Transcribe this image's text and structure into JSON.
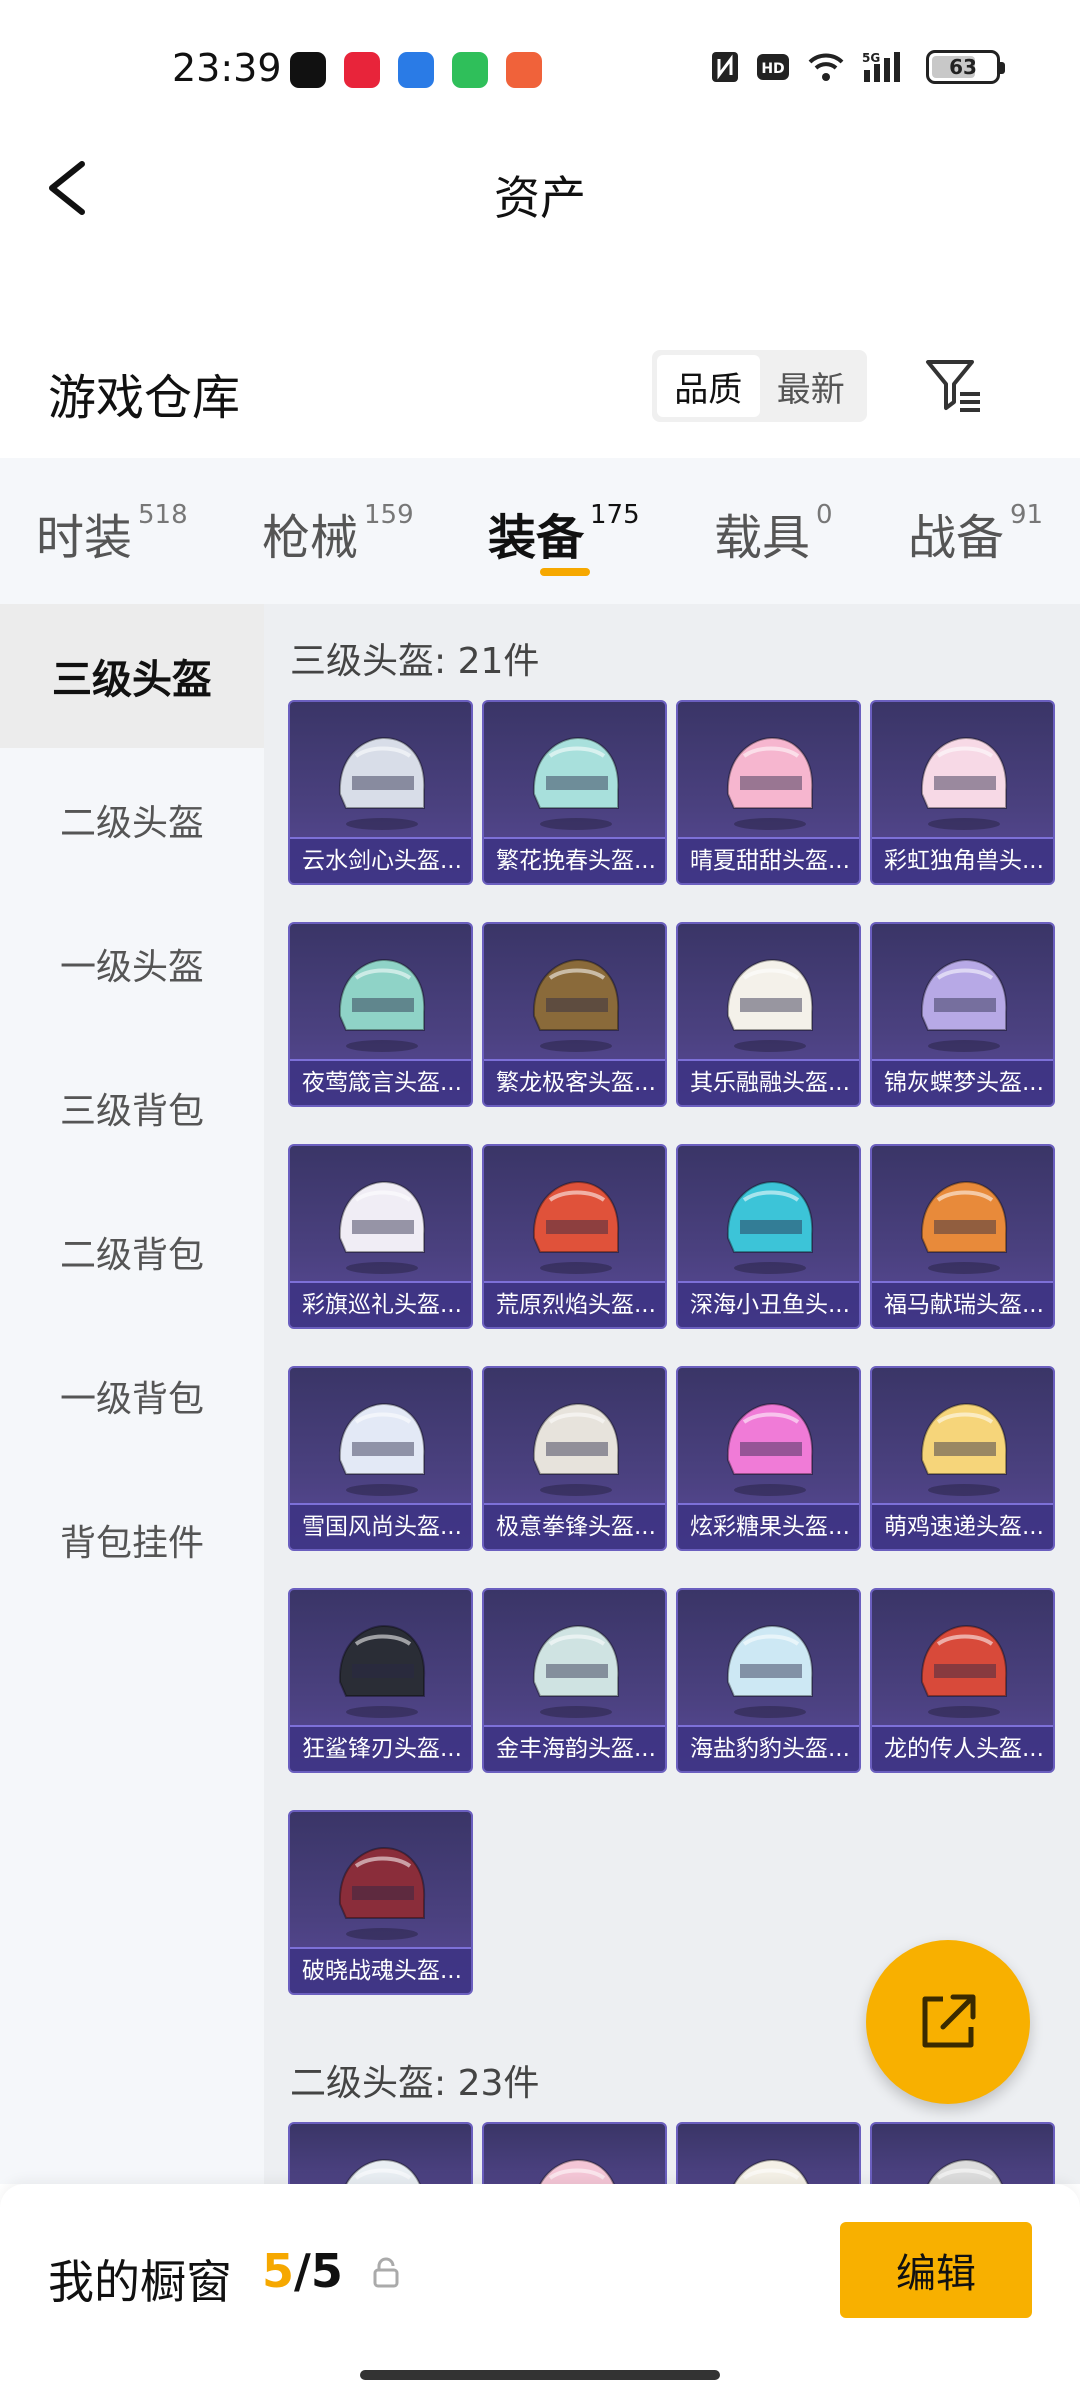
{
  "status": {
    "time": "23:39",
    "battery": "63",
    "network": "5G"
  },
  "nav": {
    "title": "资产"
  },
  "warehouse": {
    "title": "游戏仓库",
    "sort_options": [
      {
        "label": "品质"
      },
      {
        "label": "最新"
      }
    ]
  },
  "categories": [
    {
      "label": "时装",
      "count": "518"
    },
    {
      "label": "枪械",
      "count": "159"
    },
    {
      "label": "装备",
      "count": "175"
    },
    {
      "label": "载具",
      "count": "0"
    },
    {
      "label": "战备",
      "count": "91"
    }
  ],
  "sidebar": [
    {
      "label": "三级头盔"
    },
    {
      "label": "二级头盔"
    },
    {
      "label": "一级头盔"
    },
    {
      "label": "三级背包"
    },
    {
      "label": "二级背包"
    },
    {
      "label": "一级背包"
    },
    {
      "label": "背包挂件"
    }
  ],
  "groups": [
    {
      "title": "三级头盔: 21件",
      "items": [
        {
          "name": "云水剑心头盔...",
          "color": "#d8dde8"
        },
        {
          "name": "繁花挽春头盔...",
          "color": "#a8e0dc"
        },
        {
          "name": "晴夏甜甜头盔...",
          "color": "#f6b6cf"
        },
        {
          "name": "彩虹独角兽头...",
          "color": "#f7d9e6"
        },
        {
          "name": "夜莺箴言头盔...",
          "color": "#8fd3c7"
        },
        {
          "name": "繁龙极客头盔...",
          "color": "#8a6a3a"
        },
        {
          "name": "其乐融融头盔...",
          "color": "#f4f1ea"
        },
        {
          "name": "锦灰蝶梦头盔...",
          "color": "#b7a9e6"
        },
        {
          "name": "彩旗巡礼头盔...",
          "color": "#f0edf5"
        },
        {
          "name": "荒原烈焰头盔...",
          "color": "#e0523a"
        },
        {
          "name": "深海小丑鱼头...",
          "color": "#3cc4d8"
        },
        {
          "name": "福马献瑞头盔...",
          "color": "#e88a3a"
        },
        {
          "name": "雪国风尚头盔...",
          "color": "#e3e9f6"
        },
        {
          "name": "极意拳锋头盔...",
          "color": "#e7e3dc"
        },
        {
          "name": "炫彩糖果头盔...",
          "color": "#f07bd7"
        },
        {
          "name": "萌鸡速递头盔...",
          "color": "#f6d57a"
        },
        {
          "name": "狂鲨锋刃头盔...",
          "color": "#2a2d36"
        },
        {
          "name": "金丰海韵头盔...",
          "color": "#cfe3e2"
        },
        {
          "name": "海盐豹豹头盔...",
          "color": "#cde8f4"
        },
        {
          "name": "龙的传人头盔...",
          "color": "#d84a3a"
        },
        {
          "name": "破晓战魂头盔...",
          "color": "#8a2d3a"
        }
      ]
    },
    {
      "title": "二级头盔: 23件",
      "items": [
        {
          "name": "",
          "color": "#e9eef3"
        },
        {
          "name": "",
          "color": "#f4c6d6"
        },
        {
          "name": "",
          "color": "#f4f0e6"
        },
        {
          "name": "",
          "color": "#dcdcdc"
        }
      ]
    }
  ],
  "showcase": {
    "label": "我的橱窗",
    "current": "5",
    "separator": "/",
    "total": "5",
    "edit_label": "编辑"
  },
  "icons": {
    "back": "chevron-left-icon",
    "filter": "filter-icon",
    "share": "share-icon",
    "lock": "lock-icon"
  },
  "colors": {
    "accent": "#f8b000",
    "card_bg": "#3a3567"
  }
}
